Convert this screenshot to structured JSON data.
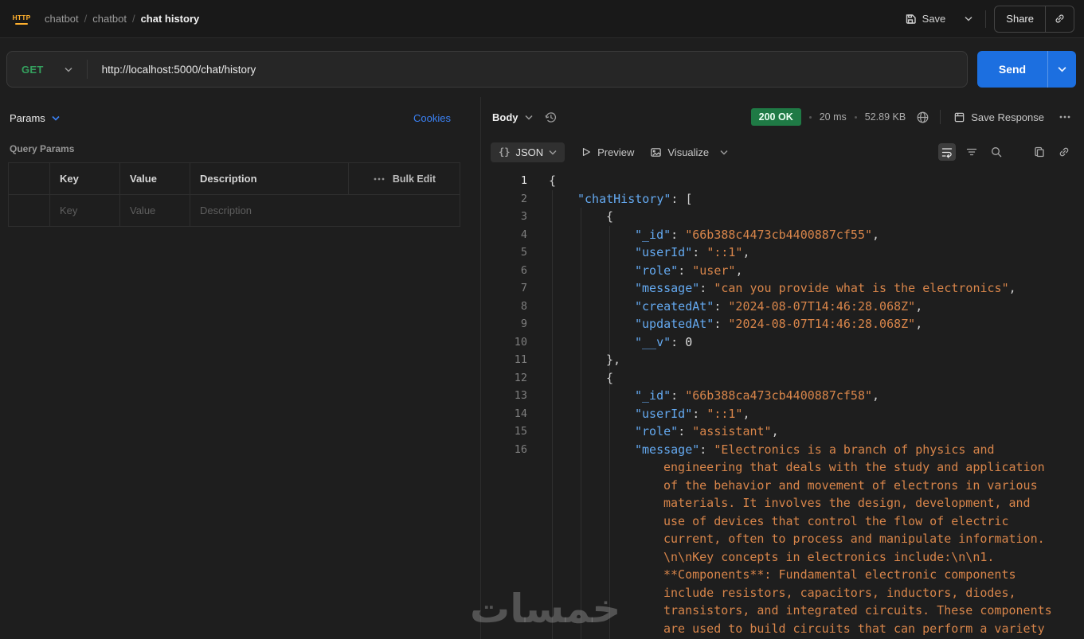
{
  "colors": {
    "accent": "#1c6fe0",
    "method-green": "#34a05e",
    "status-green": "#1f7a45",
    "link-blue": "#3b82f6",
    "key": "#64a9f0",
    "string": "#d8854a"
  },
  "header": {
    "breadcrumb": [
      "chatbot",
      "chatbot",
      "chat history"
    ],
    "save": "Save",
    "share": "Share"
  },
  "request": {
    "method": "GET",
    "url": "http://localhost:5000/chat/history",
    "send": "Send"
  },
  "params": {
    "toggle": "Params",
    "cookies": "Cookies",
    "title": "Query Params",
    "table": {
      "headers": [
        "Key",
        "Value",
        "Description"
      ],
      "bulk_edit": "Bulk Edit",
      "placeholders": [
        "Key",
        "Value",
        "Description"
      ]
    }
  },
  "response": {
    "body": "Body",
    "status": "200 OK",
    "time": "20 ms",
    "size": "52.89 KB",
    "save_response": "Save Response",
    "braces": "{}",
    "format": "JSON",
    "preview": "Preview",
    "visualize": "Visualize"
  },
  "code": {
    "lines": [
      {
        "n": "1",
        "ind": 0,
        "tok": [
          [
            "p",
            "{"
          ]
        ]
      },
      {
        "n": "2",
        "ind": 1,
        "tok": [
          [
            "k",
            "\"chatHistory\""
          ],
          [
            "p",
            ": ["
          ]
        ]
      },
      {
        "n": "3",
        "ind": 2,
        "tok": [
          [
            "p",
            "{"
          ]
        ]
      },
      {
        "n": "4",
        "ind": 3,
        "tok": [
          [
            "k",
            "\"_id\""
          ],
          [
            "p",
            ": "
          ],
          [
            "s",
            "\"66b388c4473cb4400887cf55\""
          ],
          [
            "p",
            ","
          ]
        ]
      },
      {
        "n": "5",
        "ind": 3,
        "tok": [
          [
            "k",
            "\"userId\""
          ],
          [
            "p",
            ": "
          ],
          [
            "s",
            "\"::1\""
          ],
          [
            "p",
            ","
          ]
        ]
      },
      {
        "n": "6",
        "ind": 3,
        "tok": [
          [
            "k",
            "\"role\""
          ],
          [
            "p",
            ": "
          ],
          [
            "s",
            "\"user\""
          ],
          [
            "p",
            ","
          ]
        ]
      },
      {
        "n": "7",
        "ind": 3,
        "tok": [
          [
            "k",
            "\"message\""
          ],
          [
            "p",
            ": "
          ],
          [
            "s",
            "\"can you provide what is the electronics\""
          ],
          [
            "p",
            ","
          ]
        ]
      },
      {
        "n": "8",
        "ind": 3,
        "tok": [
          [
            "k",
            "\"createdAt\""
          ],
          [
            "p",
            ": "
          ],
          [
            "s",
            "\"2024-08-07T14:46:28.068Z\""
          ],
          [
            "p",
            ","
          ]
        ]
      },
      {
        "n": "9",
        "ind": 3,
        "tok": [
          [
            "k",
            "\"updatedAt\""
          ],
          [
            "p",
            ": "
          ],
          [
            "s",
            "\"2024-08-07T14:46:28.068Z\""
          ],
          [
            "p",
            ","
          ]
        ]
      },
      {
        "n": "10",
        "ind": 3,
        "tok": [
          [
            "k",
            "\"__v\""
          ],
          [
            "p",
            ": "
          ],
          [
            "n",
            "0"
          ]
        ]
      },
      {
        "n": "11",
        "ind": 2,
        "tok": [
          [
            "p",
            "},"
          ]
        ]
      },
      {
        "n": "12",
        "ind": 2,
        "tok": [
          [
            "p",
            "{"
          ]
        ]
      },
      {
        "n": "13",
        "ind": 3,
        "tok": [
          [
            "k",
            "\"_id\""
          ],
          [
            "p",
            ": "
          ],
          [
            "s",
            "\"66b388ca473cb4400887cf58\""
          ],
          [
            "p",
            ","
          ]
        ]
      },
      {
        "n": "14",
        "ind": 3,
        "tok": [
          [
            "k",
            "\"userId\""
          ],
          [
            "p",
            ": "
          ],
          [
            "s",
            "\"::1\""
          ],
          [
            "p",
            ","
          ]
        ]
      },
      {
        "n": "15",
        "ind": 3,
        "tok": [
          [
            "k",
            "\"role\""
          ],
          [
            "p",
            ": "
          ],
          [
            "s",
            "\"assistant\""
          ],
          [
            "p",
            ","
          ]
        ]
      },
      {
        "n": "16",
        "ind": 3,
        "tok": [
          [
            "k",
            "\"message\""
          ],
          [
            "p",
            ": "
          ],
          [
            "s",
            "\"Electronics is a branch of physics and engineering that deals with the study and application of the behavior and movement of electrons in various materials. It involves the design, development, and use of devices that control the flow of electric current, often to process and manipulate information. \\n\\nKey concepts in electronics include:\\n\\n1. **Components**: Fundamental electronic components include resistors, capacitors, inductors, diodes, transistors, and integrated circuits. These components are used to build circuits that can perform a variety"
          ]
        ]
      }
    ]
  },
  "watermark": "خمسات"
}
